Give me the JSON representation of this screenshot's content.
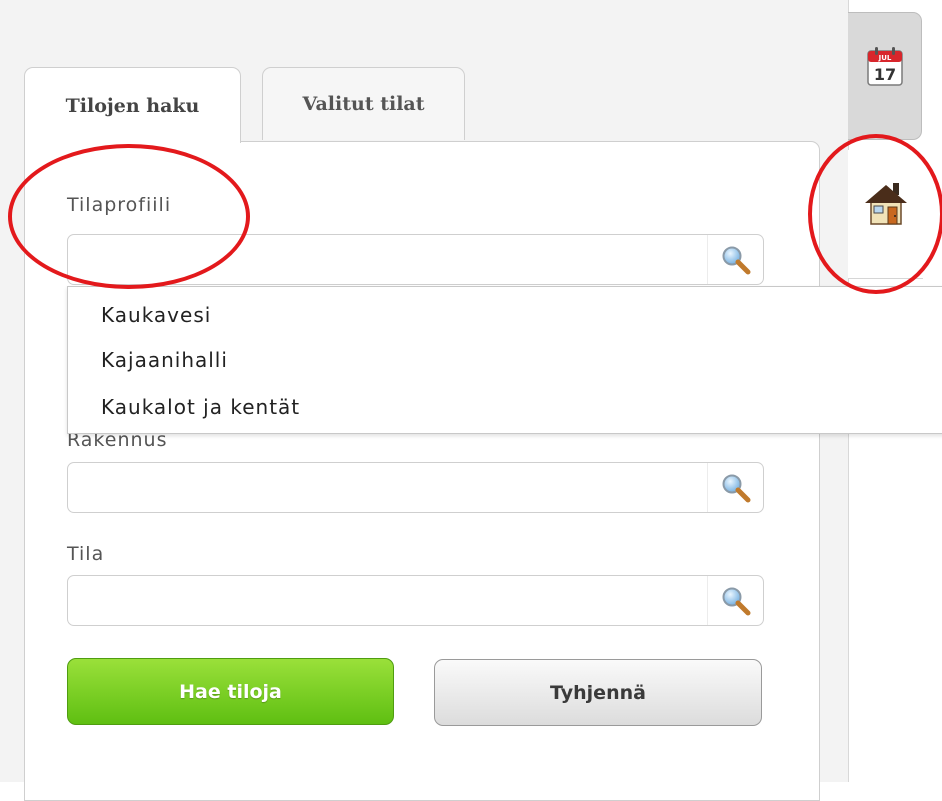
{
  "tabs": {
    "search": "Tilojen haku",
    "selected": "Valitut tilat"
  },
  "fields": {
    "profile_label": "Tilaprofiili",
    "profile_value": "",
    "building_label": "Rakennus",
    "building_value": "",
    "space_label": "Tila",
    "space_value": ""
  },
  "dropdown": {
    "options": [
      "Kaukavesi",
      "Kajaanihalli",
      "Kaukalot ja kentät"
    ]
  },
  "buttons": {
    "search": "Hae tiloja",
    "clear": "Tyhjennä"
  },
  "calendar_icon": {
    "month": "JUL",
    "day": "17"
  },
  "icons": [
    "magnifier-icon",
    "calendar-icon",
    "house-icon"
  ],
  "colors": {
    "annotation_red": "#e3191c",
    "primary_green": "#6cc91c"
  }
}
